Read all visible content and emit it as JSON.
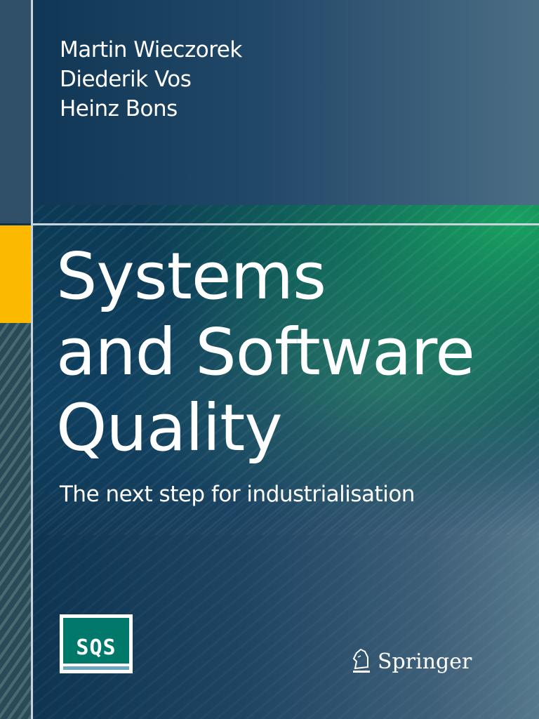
{
  "authors": [
    "Martin Wieczorek",
    "Diederik Vos",
    "Heinz Bons"
  ],
  "title_lines": [
    "Systems",
    "and Software",
    "Quality"
  ],
  "subtitle": "The next step for industrialisation",
  "logos": {
    "sqs": "SQS",
    "publisher": "Springer"
  },
  "colors": {
    "accent_yellow": "#fbb900",
    "sqs_green": "#00796b",
    "background": "#0b3350"
  }
}
